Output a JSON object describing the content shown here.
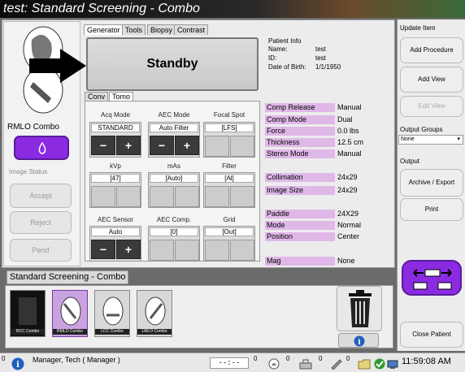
{
  "title": "test: Standard Screening - Combo",
  "tabs": [
    "Generator",
    "Tools",
    "Biopsy",
    "Contrast"
  ],
  "left": {
    "view_label": "RMLO Combo",
    "image_status_label": "Image Status",
    "accept": "Accept",
    "reject": "Reject",
    "pend": "Pend"
  },
  "generator": {
    "status": "Standby",
    "patient": {
      "header": "Patient Info",
      "name_label": "Name:",
      "name_value": "test",
      "id_label": "ID:",
      "id_value": "test",
      "dob_label": "Date of Birth:",
      "dob_value": "1/1/1950"
    },
    "subtabs": [
      "Conv",
      "Tomo"
    ],
    "params": {
      "acq_mode": {
        "title": "Acq Mode",
        "value": "STANDARD"
      },
      "aec_mode": {
        "title": "AEC Mode",
        "value": "Auto Filter"
      },
      "focal_spot": {
        "title": "Focal Spot",
        "value": "[LFS]"
      },
      "kvp": {
        "title": "kVp",
        "value": "[47]"
      },
      "mas": {
        "title": "mAs",
        "value": "[Auto]"
      },
      "filter": {
        "title": "Filter",
        "value": "[Al]"
      },
      "aec_sensor": {
        "title": "AEC Sensor",
        "value": "Auto"
      },
      "aec_comp": {
        "title": "AEC Comp.",
        "value": "[0]"
      },
      "grid": {
        "title": "Grid",
        "value": "[Out]"
      }
    },
    "minus": "−",
    "plus": "+",
    "fields": [
      {
        "label": "Comp Release",
        "value": "Manual"
      },
      {
        "label": "Comp Mode",
        "value": "Dual"
      },
      {
        "label": "Force",
        "value": "0.0 lbs"
      },
      {
        "label": "Thickness",
        "value": "12.5 cm"
      },
      {
        "label": "Stereo Mode",
        "value": "Manual"
      },
      {
        "label": "Collimation",
        "value": "24x29"
      },
      {
        "label": "Image Size",
        "value": "24x29"
      },
      {
        "label": "Paddle",
        "value": "24X29"
      },
      {
        "label": "Mode",
        "value": "Normal"
      },
      {
        "label": "Position",
        "value": "Center"
      },
      {
        "label": "Mag",
        "value": "None"
      }
    ]
  },
  "right": {
    "update_item": "Update Item",
    "add_procedure": "Add Procedure",
    "add_view": "Add View",
    "edit_view": "Edit View",
    "output_groups": "Output Groups",
    "output_groups_value": "None",
    "output": "Output",
    "archive_export": "Archive / Export",
    "print": "Print",
    "close_patient": "Close Patient"
  },
  "strip": {
    "header": "Standard Screening - Combo",
    "thumbs": [
      "RCC Combo",
      "RMLO Combo",
      "LCC Combo",
      "LMLO Combo"
    ]
  },
  "status": {
    "count_left": "0",
    "user": "Manager, Tech ( Manager )",
    "timer": "--:--",
    "c1": "0",
    "c2": "0",
    "c3": "0",
    "c4": "0",
    "clock": "11:59:08 AM"
  },
  "colors": {
    "accent_purple": "#8a2be2",
    "label_purple": "#e0b8e8"
  }
}
